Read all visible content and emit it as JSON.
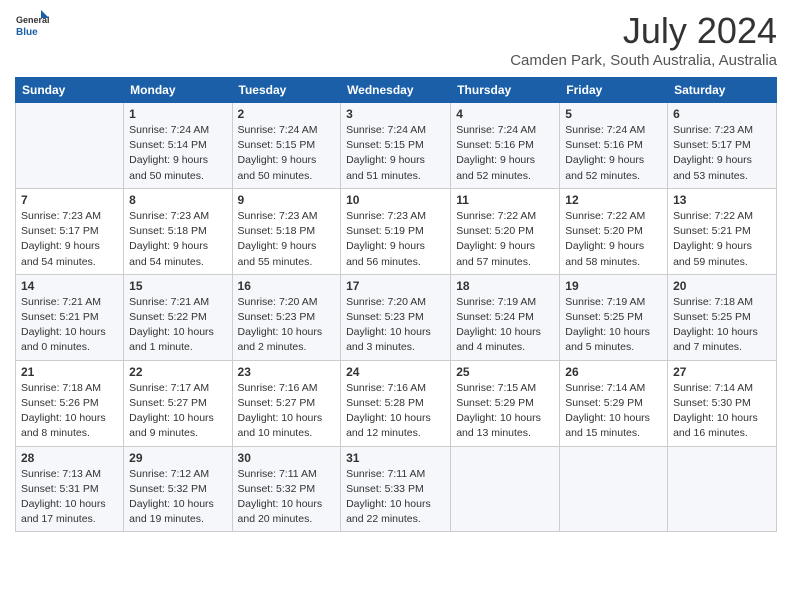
{
  "logo": {
    "text_general": "General",
    "text_blue": "Blue"
  },
  "title": "July 2024",
  "location": "Camden Park, South Australia, Australia",
  "days_header": [
    "Sunday",
    "Monday",
    "Tuesday",
    "Wednesday",
    "Thursday",
    "Friday",
    "Saturday"
  ],
  "weeks": [
    [
      {
        "num": "",
        "info": ""
      },
      {
        "num": "1",
        "info": "Sunrise: 7:24 AM\nSunset: 5:14 PM\nDaylight: 9 hours\nand 50 minutes."
      },
      {
        "num": "2",
        "info": "Sunrise: 7:24 AM\nSunset: 5:15 PM\nDaylight: 9 hours\nand 50 minutes."
      },
      {
        "num": "3",
        "info": "Sunrise: 7:24 AM\nSunset: 5:15 PM\nDaylight: 9 hours\nand 51 minutes."
      },
      {
        "num": "4",
        "info": "Sunrise: 7:24 AM\nSunset: 5:16 PM\nDaylight: 9 hours\nand 52 minutes."
      },
      {
        "num": "5",
        "info": "Sunrise: 7:24 AM\nSunset: 5:16 PM\nDaylight: 9 hours\nand 52 minutes."
      },
      {
        "num": "6",
        "info": "Sunrise: 7:23 AM\nSunset: 5:17 PM\nDaylight: 9 hours\nand 53 minutes."
      }
    ],
    [
      {
        "num": "7",
        "info": "Sunrise: 7:23 AM\nSunset: 5:17 PM\nDaylight: 9 hours\nand 54 minutes."
      },
      {
        "num": "8",
        "info": "Sunrise: 7:23 AM\nSunset: 5:18 PM\nDaylight: 9 hours\nand 54 minutes."
      },
      {
        "num": "9",
        "info": "Sunrise: 7:23 AM\nSunset: 5:18 PM\nDaylight: 9 hours\nand 55 minutes."
      },
      {
        "num": "10",
        "info": "Sunrise: 7:23 AM\nSunset: 5:19 PM\nDaylight: 9 hours\nand 56 minutes."
      },
      {
        "num": "11",
        "info": "Sunrise: 7:22 AM\nSunset: 5:20 PM\nDaylight: 9 hours\nand 57 minutes."
      },
      {
        "num": "12",
        "info": "Sunrise: 7:22 AM\nSunset: 5:20 PM\nDaylight: 9 hours\nand 58 minutes."
      },
      {
        "num": "13",
        "info": "Sunrise: 7:22 AM\nSunset: 5:21 PM\nDaylight: 9 hours\nand 59 minutes."
      }
    ],
    [
      {
        "num": "14",
        "info": "Sunrise: 7:21 AM\nSunset: 5:21 PM\nDaylight: 10 hours\nand 0 minutes."
      },
      {
        "num": "15",
        "info": "Sunrise: 7:21 AM\nSunset: 5:22 PM\nDaylight: 10 hours\nand 1 minute."
      },
      {
        "num": "16",
        "info": "Sunrise: 7:20 AM\nSunset: 5:23 PM\nDaylight: 10 hours\nand 2 minutes."
      },
      {
        "num": "17",
        "info": "Sunrise: 7:20 AM\nSunset: 5:23 PM\nDaylight: 10 hours\nand 3 minutes."
      },
      {
        "num": "18",
        "info": "Sunrise: 7:19 AM\nSunset: 5:24 PM\nDaylight: 10 hours\nand 4 minutes."
      },
      {
        "num": "19",
        "info": "Sunrise: 7:19 AM\nSunset: 5:25 PM\nDaylight: 10 hours\nand 5 minutes."
      },
      {
        "num": "20",
        "info": "Sunrise: 7:18 AM\nSunset: 5:25 PM\nDaylight: 10 hours\nand 7 minutes."
      }
    ],
    [
      {
        "num": "21",
        "info": "Sunrise: 7:18 AM\nSunset: 5:26 PM\nDaylight: 10 hours\nand 8 minutes."
      },
      {
        "num": "22",
        "info": "Sunrise: 7:17 AM\nSunset: 5:27 PM\nDaylight: 10 hours\nand 9 minutes."
      },
      {
        "num": "23",
        "info": "Sunrise: 7:16 AM\nSunset: 5:27 PM\nDaylight: 10 hours\nand 10 minutes."
      },
      {
        "num": "24",
        "info": "Sunrise: 7:16 AM\nSunset: 5:28 PM\nDaylight: 10 hours\nand 12 minutes."
      },
      {
        "num": "25",
        "info": "Sunrise: 7:15 AM\nSunset: 5:29 PM\nDaylight: 10 hours\nand 13 minutes."
      },
      {
        "num": "26",
        "info": "Sunrise: 7:14 AM\nSunset: 5:29 PM\nDaylight: 10 hours\nand 15 minutes."
      },
      {
        "num": "27",
        "info": "Sunrise: 7:14 AM\nSunset: 5:30 PM\nDaylight: 10 hours\nand 16 minutes."
      }
    ],
    [
      {
        "num": "28",
        "info": "Sunrise: 7:13 AM\nSunset: 5:31 PM\nDaylight: 10 hours\nand 17 minutes."
      },
      {
        "num": "29",
        "info": "Sunrise: 7:12 AM\nSunset: 5:32 PM\nDaylight: 10 hours\nand 19 minutes."
      },
      {
        "num": "30",
        "info": "Sunrise: 7:11 AM\nSunset: 5:32 PM\nDaylight: 10 hours\nand 20 minutes."
      },
      {
        "num": "31",
        "info": "Sunrise: 7:11 AM\nSunset: 5:33 PM\nDaylight: 10 hours\nand 22 minutes."
      },
      {
        "num": "",
        "info": ""
      },
      {
        "num": "",
        "info": ""
      },
      {
        "num": "",
        "info": ""
      }
    ]
  ]
}
